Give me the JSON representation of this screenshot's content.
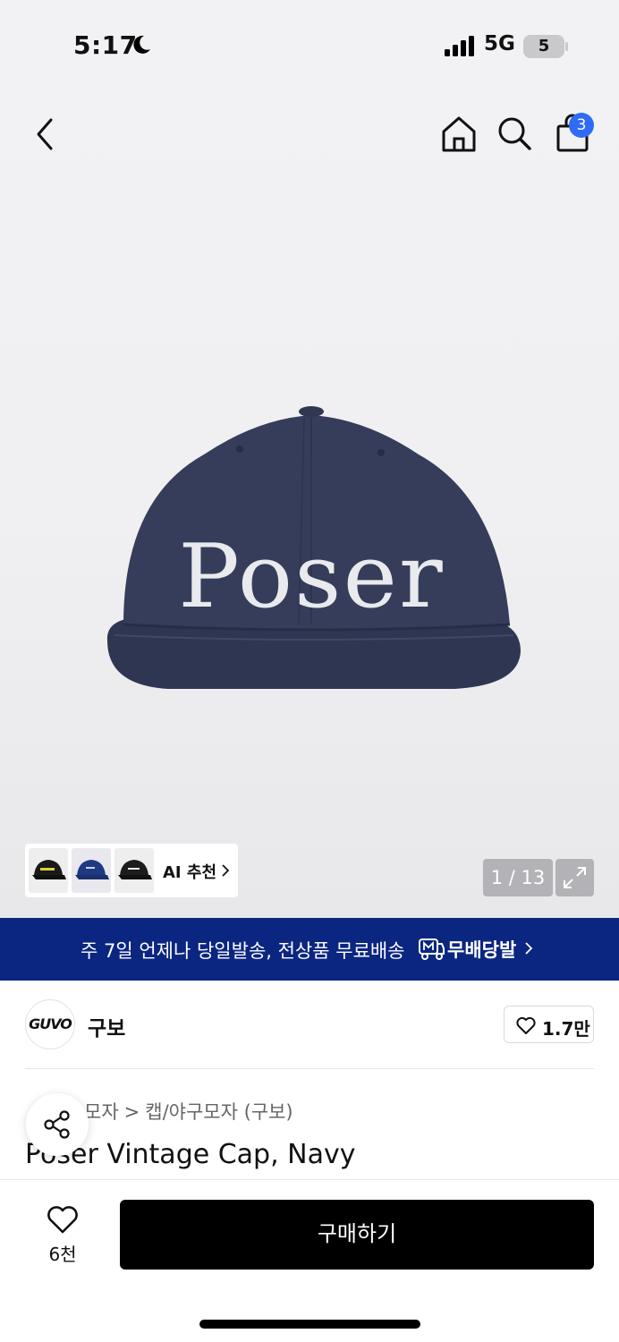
{
  "status_bar": {
    "time": "5:17",
    "network": "5G",
    "battery": "5"
  },
  "header": {
    "cart_count": "3"
  },
  "product_image": {
    "cap_text": "Poser",
    "counter": "1 / 13"
  },
  "ai_recommend": {
    "label": "AI 추천",
    "thumbnails": [
      "black-cap",
      "blue-cap",
      "black-cap"
    ]
  },
  "delivery_banner": {
    "text": "주 7일 언제나 당일발송, 전상품 무료배송",
    "brand": "무배당발"
  },
  "brand": {
    "logo_text": "GUVO",
    "name": "구보",
    "likes": "1.7만"
  },
  "breadcrumb": {
    "items": [
      "모자",
      "캡/야구모자 (구보)"
    ],
    "separator": ">"
  },
  "product": {
    "title": "Poser Vintage Cap, Navy"
  },
  "bottom_bar": {
    "like_count": "6천",
    "buy_label": "구매하기"
  },
  "colors": {
    "banner_bg": "#0b2681",
    "badge": "#2f6cf5",
    "cap_navy": "#343c58",
    "buy_bg": "#000000"
  }
}
